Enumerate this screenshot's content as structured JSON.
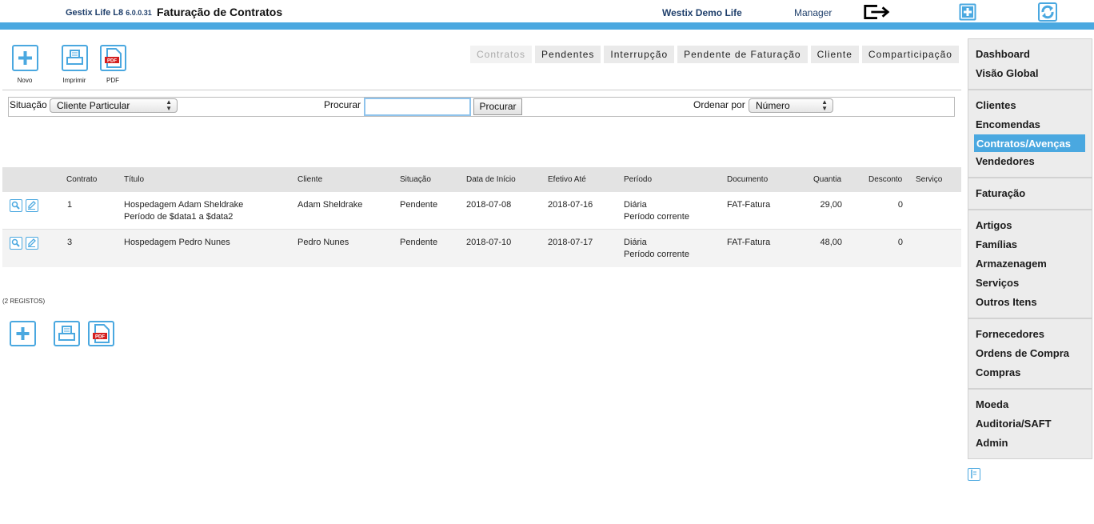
{
  "header": {
    "app_name": "Gestix Life L8",
    "version": "6.0.0.31",
    "page_title": "Faturação de Contratos",
    "company": "Westix Demo Life",
    "user": "Manager",
    "icons": [
      "logout-icon",
      "add-icon",
      "refresh-icon"
    ]
  },
  "toolbar": {
    "new_label": "Novo",
    "print_label": "Imprimir",
    "pdf_label": "PDF",
    "pdf_badge": "PDF"
  },
  "tabs": [
    {
      "label": "Contratos",
      "active": true
    },
    {
      "label": "Pendentes",
      "active": false
    },
    {
      "label": "Interrupção",
      "active": false
    },
    {
      "label": "Pendente de Faturação",
      "active": false
    },
    {
      "label": "Cliente",
      "active": false
    },
    {
      "label": "Comparticipação",
      "active": false
    }
  ],
  "filter": {
    "situacao_label": "Situação",
    "situacao_value": "Cliente Particular",
    "procurar_label": "Procurar",
    "search_value": "",
    "search_button": "Procurar",
    "ordenar_label": "Ordenar por",
    "ordenar_value": "Número"
  },
  "table": {
    "columns": [
      "Contrato",
      "Título",
      "Cliente",
      "Situação",
      "Data de Início",
      "Efetivo Até",
      "Período",
      "Documento",
      "Quantia",
      "Desconto",
      "Serviço"
    ],
    "rows": [
      {
        "contrato": "1",
        "titulo": "Hospedagem Adam Sheldrake",
        "titulo2": "Período de $data1 a $data2",
        "cliente": "Adam Sheldrake",
        "situacao": "Pendente",
        "data_inicio": "2018-07-08",
        "efetivo_ate": "2018-07-16",
        "periodo": "Diária",
        "periodo2": "Período corrente",
        "documento": "FAT-Fatura",
        "quantia": "29,00",
        "desconto": "0",
        "servico": ""
      },
      {
        "contrato": "3",
        "titulo": "Hospedagem Pedro Nunes",
        "titulo2": "",
        "cliente": "Pedro Nunes",
        "situacao": "Pendente",
        "data_inicio": "2018-07-10",
        "efetivo_ate": "2018-07-17",
        "periodo": "Diária",
        "periodo2": "Período corrente",
        "documento": "FAT-Fatura",
        "quantia": "48,00",
        "desconto": "0",
        "servico": ""
      }
    ]
  },
  "records_count": "(2 REGISTOS)",
  "sidebar": {
    "groups": [
      [
        "Dashboard",
        "Visão Global"
      ],
      [
        "Clientes",
        "Encomendas",
        "Contratos/Avenças",
        "Vendedores"
      ],
      [
        "Faturação"
      ],
      [
        "Artigos",
        "Famílias",
        "Armazenagem",
        "Serviços",
        "Outros Itens"
      ],
      [
        "Fornecedores",
        "Ordens de Compra",
        "Compras"
      ],
      [
        "Moeda",
        "Auditoria/SAFT",
        "Admin"
      ]
    ],
    "active_item": "Contratos/Avenças"
  },
  "colors": {
    "accent": "#4aa8e0",
    "header_text": "#1f3f6b"
  }
}
